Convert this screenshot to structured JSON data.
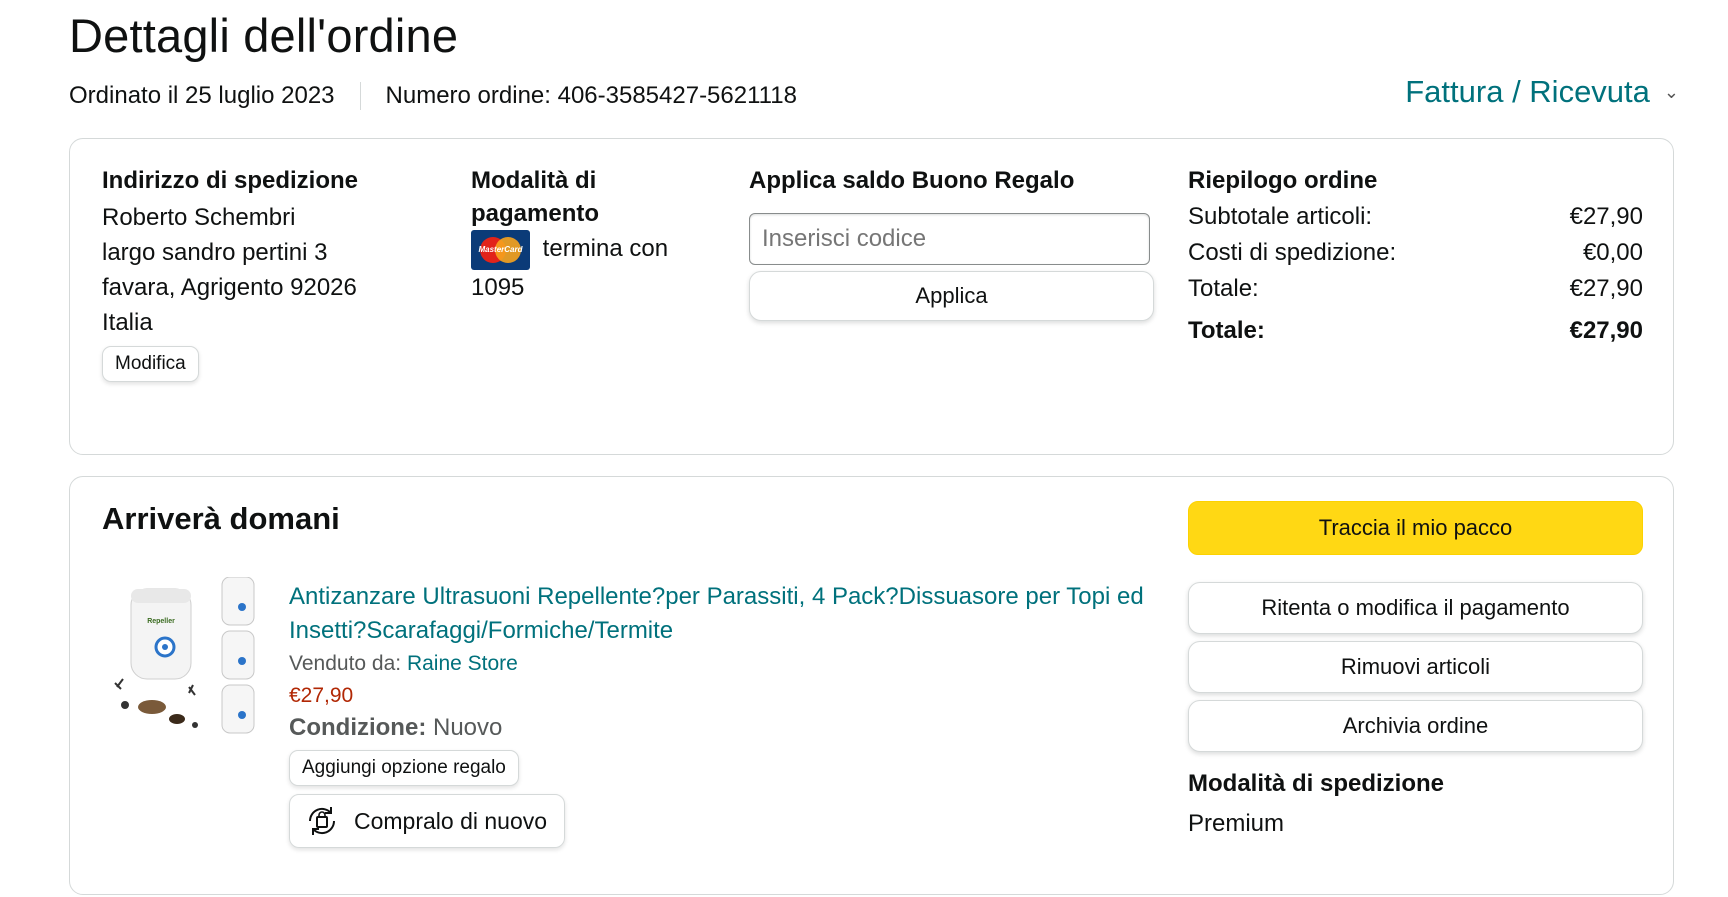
{
  "header": {
    "title": "Dettagli dell'ordine",
    "ordered": "Ordinato il 25 luglio 2023",
    "order_number": "Numero ordine: 406-3585427-5621118",
    "invoice_link": "Fattura / Ricevuta"
  },
  "shipping": {
    "heading": "Indirizzo di spedizione",
    "lines": [
      "Roberto Schembri",
      "largo sandro pertini 3",
      "favara, Agrigento 92026",
      "Italia"
    ],
    "edit_label": "Modifica"
  },
  "payment": {
    "heading_line1": "Modalità di",
    "heading_line2": "pagamento",
    "card_logo_text": "MasterCard",
    "ends_with": "termina con",
    "last_digits": "1095"
  },
  "gift": {
    "heading": "Applica saldo Buono Regalo",
    "placeholder": "Inserisci codice",
    "apply_label": "Applica"
  },
  "summary": {
    "heading": "Riepilogo ordine",
    "rows": [
      {
        "label": "Subtotale articoli:",
        "value": "€27,90"
      },
      {
        "label": "Costi di spedizione:",
        "value": "€0,00"
      },
      {
        "label": "Totale:",
        "value": "€27,90"
      }
    ],
    "grand_total_label": "Totale:",
    "grand_total_value": "€27,90"
  },
  "shipment": {
    "heading": "Arriverà domani",
    "product": {
      "title": "Antizanzare Ultrasuoni Repellente?per Parassiti, 4 Pack?Dissuasore per Topi ed Insetti?Scarafaggi/Formiche/Termite",
      "sold_by_label": "Venduto da: ",
      "seller": "Raine Store",
      "price": "€27,90",
      "condition_label": "Condizione:",
      "condition_value": "Nuovo",
      "gift_option_label": "Aggiungi opzione regalo",
      "buy_again_label": "Compralo di nuovo",
      "brand_text": "Repeller"
    },
    "actions": {
      "track": "Traccia il mio pacco",
      "retry_payment": "Ritenta o modifica il pagamento",
      "remove_items": "Rimuovi articoli",
      "archive": "Archivia ordine"
    },
    "shipping_method_heading": "Modalità di spedizione",
    "shipping_method": "Premium"
  },
  "colors": {
    "link": "#00717c",
    "track_button": "#ffd814",
    "price": "#b12704"
  }
}
